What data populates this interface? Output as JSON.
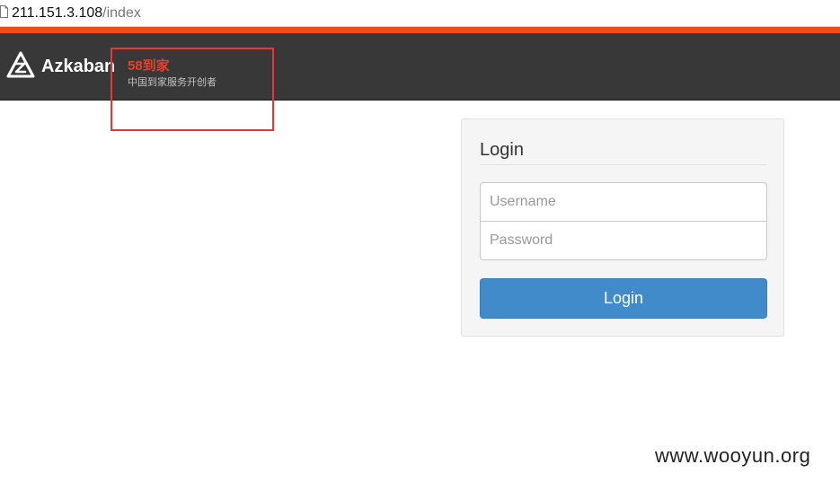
{
  "browser": {
    "url_host": "211.151.3.108",
    "url_path": "/index"
  },
  "navbar": {
    "brand_name": "Azkaban",
    "brand_tag": "58到家",
    "brand_subtitle": "中国到家服务开创者",
    "logo_icon": "azkaban-logo-icon"
  },
  "login": {
    "title": "Login",
    "username_placeholder": "Username",
    "password_placeholder": "Password",
    "username_value": "",
    "password_value": "",
    "button_label": "Login"
  },
  "watermark": "www.wooyun.org",
  "colors": {
    "accent": "#f24c1a",
    "navbar_bg": "#383838",
    "brand_tag": "#e8402a",
    "button_primary": "#428bca",
    "highlight_box": "#e53935"
  }
}
